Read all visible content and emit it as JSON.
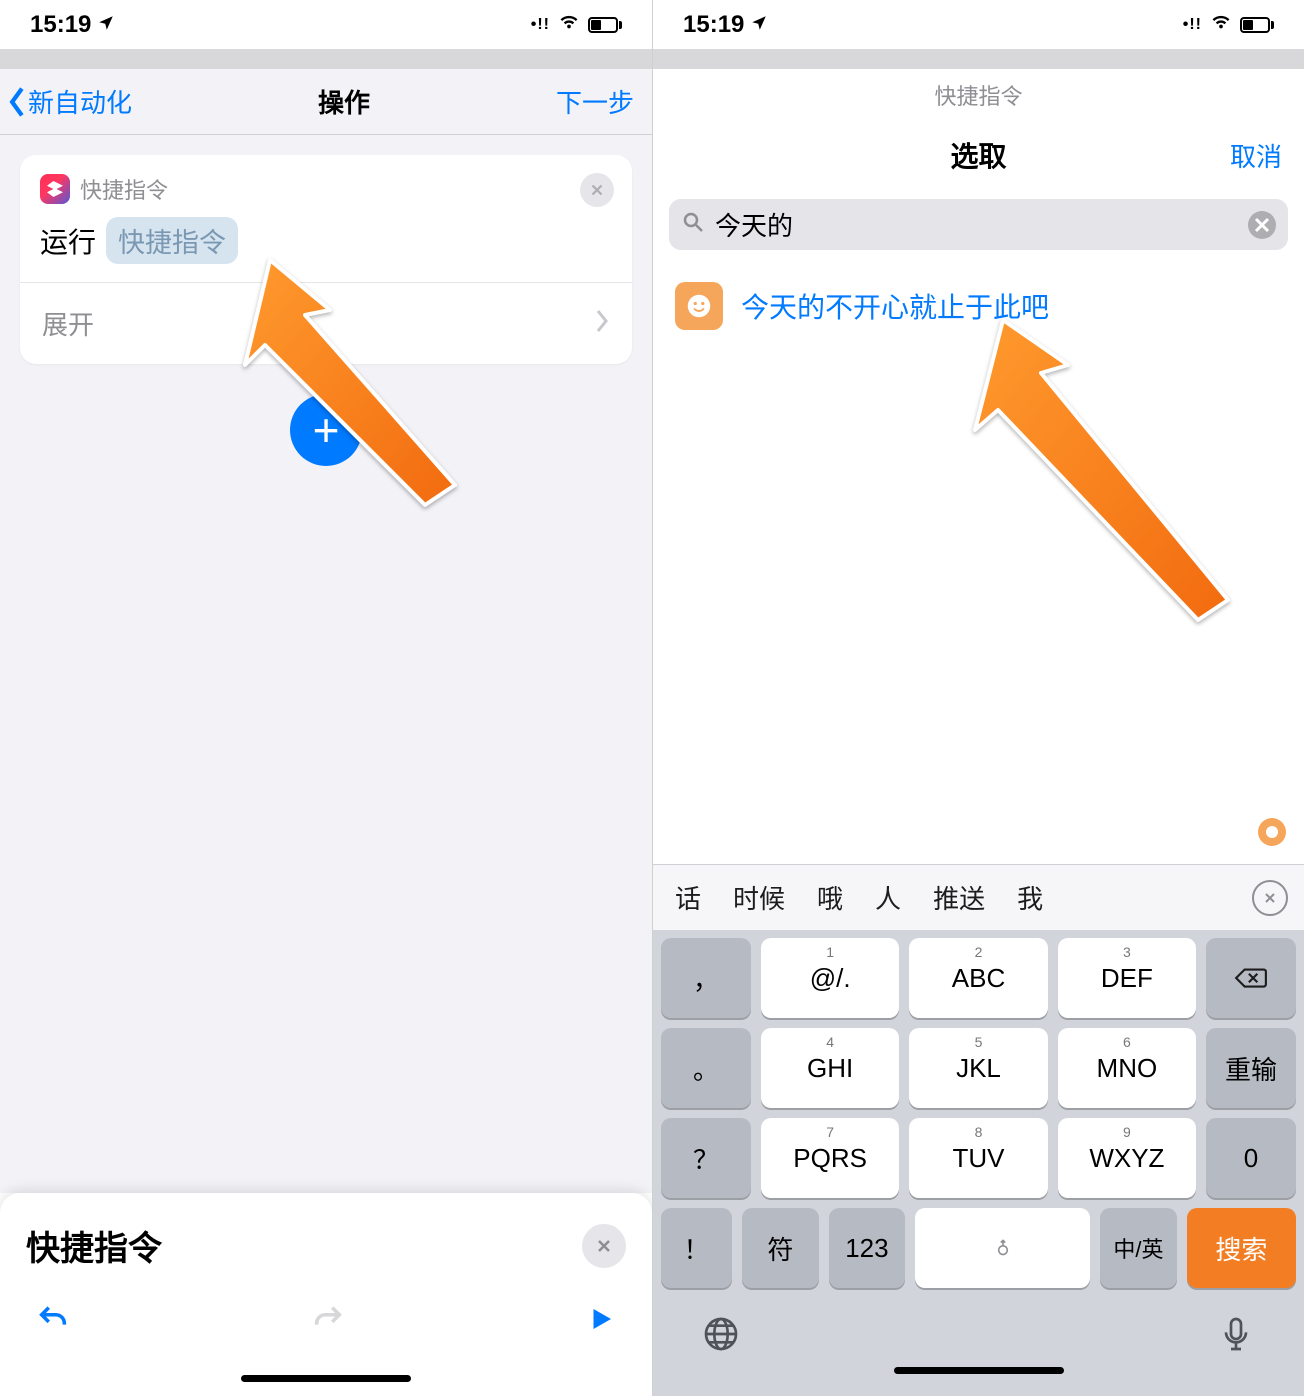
{
  "status": {
    "time": "15:19"
  },
  "left": {
    "nav_back": "新自动化",
    "nav_title": "操作",
    "nav_next": "下一步",
    "card": {
      "app_label": "快捷指令",
      "run_label": "运行",
      "pill": "快捷指令",
      "expand_label": "展开"
    },
    "panel_title": "快捷指令"
  },
  "right": {
    "mini_title": "快捷指令",
    "nav_title": "选取",
    "cancel": "取消",
    "search_value": "今天的",
    "result": "今天的不开心就止于此吧",
    "suggestions": [
      "话",
      "时候",
      "哦",
      "人",
      "推送",
      "我"
    ],
    "keys": {
      "r1": [
        "@/.",
        "ABC",
        "DEF"
      ],
      "r1_nums": [
        "1",
        "2",
        "3"
      ],
      "r2": [
        "GHI",
        "JKL",
        "MNO"
      ],
      "r2_nums": [
        "4",
        "5",
        "6"
      ],
      "r3": [
        "PQRS",
        "TUV",
        "WXYZ"
      ],
      "r3_nums": [
        "7",
        "8",
        "9"
      ],
      "left_col": [
        "，",
        "。",
        "？",
        "！"
      ],
      "right_col": {
        "reinput": "重输",
        "zero": "0",
        "search": "搜索"
      },
      "bottom": {
        "fu": "符",
        "num": "123",
        "lang": "中/英"
      }
    }
  }
}
